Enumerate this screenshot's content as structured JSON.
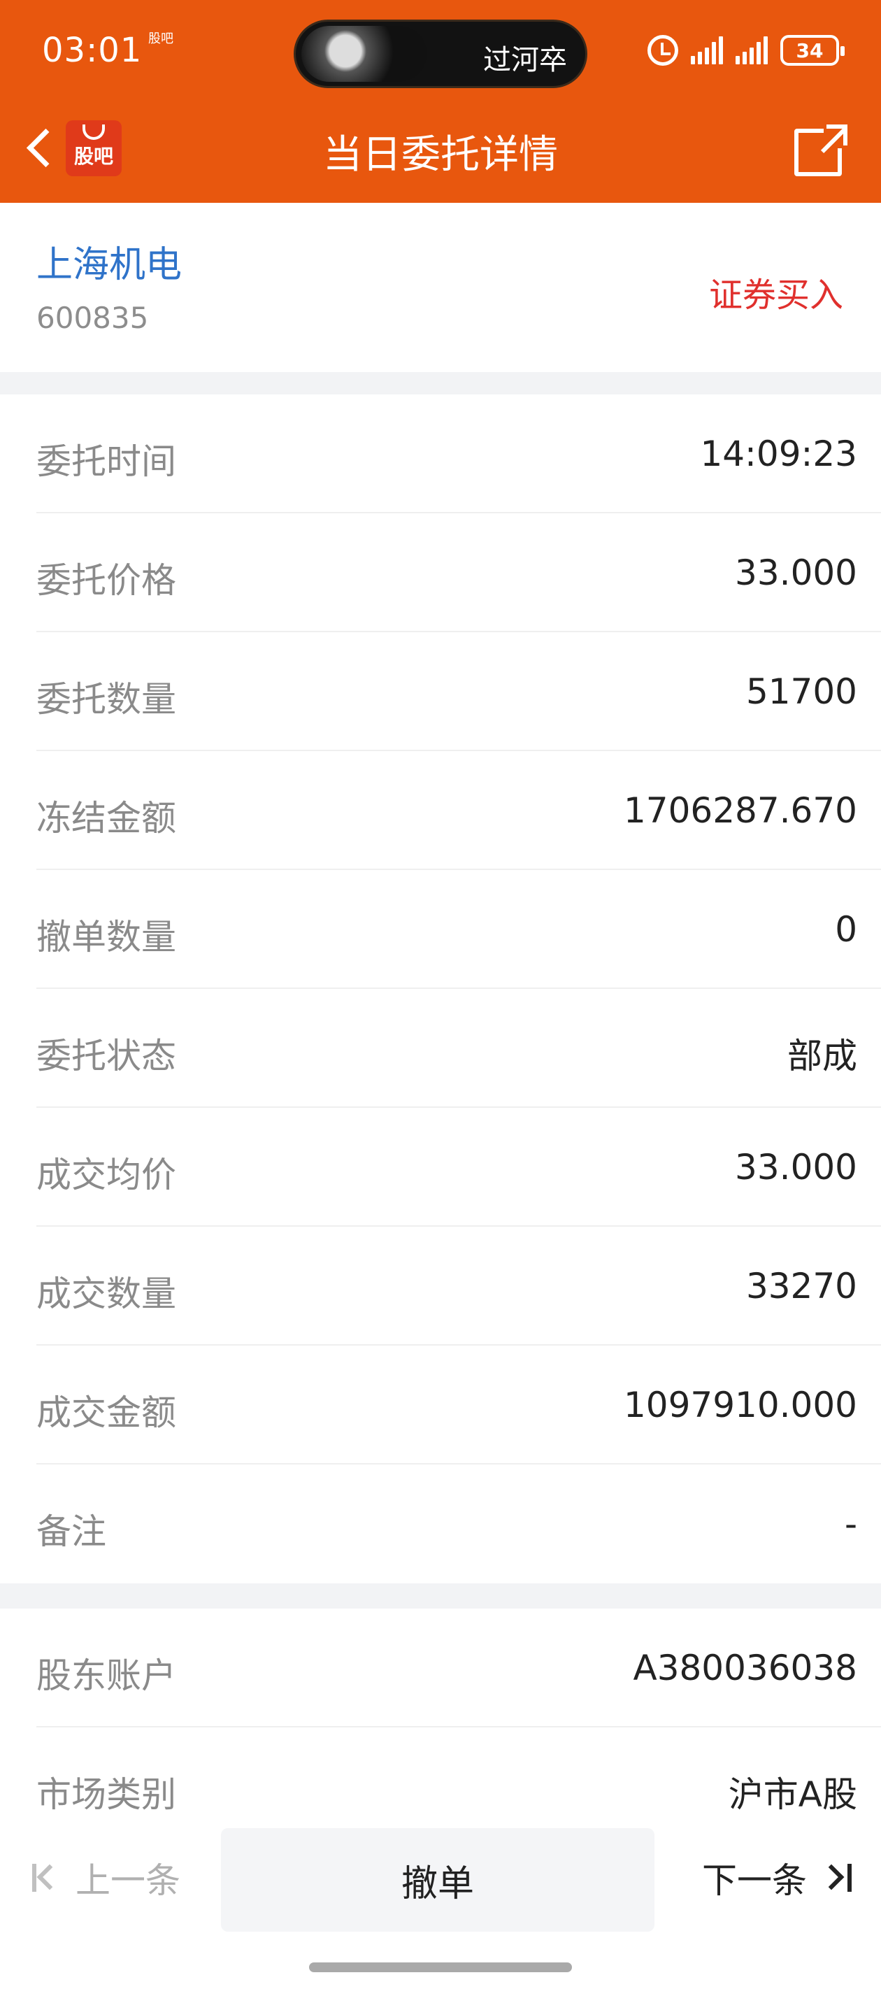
{
  "status_bar": {
    "time": "03:01",
    "app_icon": "股吧",
    "island_text": "过河卒",
    "battery": "34",
    "icons": [
      "alarm-icon",
      "signal-icon",
      "battery-icon"
    ]
  },
  "nav": {
    "title": "当日委托详情",
    "logo_text": "股吧",
    "back_icon": "chevron-left-icon",
    "share_icon": "share-icon"
  },
  "stock": {
    "name": "上海机电",
    "code": "600835",
    "trade_type": "证券买入"
  },
  "details": [
    {
      "label": "委托时间",
      "value": "14:09:23"
    },
    {
      "label": "委托价格",
      "value": "33.000"
    },
    {
      "label": "委托数量",
      "value": "51700"
    },
    {
      "label": "冻结金额",
      "value": "1706287.670"
    },
    {
      "label": "撤单数量",
      "value": "0"
    },
    {
      "label": "委托状态",
      "value": "部成"
    },
    {
      "label": "成交均价",
      "value": "33.000"
    },
    {
      "label": "成交数量",
      "value": "33270"
    },
    {
      "label": "成交金额",
      "value": "1097910.000"
    },
    {
      "label": "备注",
      "value": "-"
    }
  ],
  "account": [
    {
      "label": "股东账户",
      "value": "A380036038"
    },
    {
      "label": "市场类别",
      "value": "沪市A股"
    }
  ],
  "bottom": {
    "prev_label": "上一条",
    "cancel_label": "撤单",
    "next_label": "下一条"
  },
  "colors": {
    "header_bg": "#e8570e",
    "stock_name": "#2f73c9",
    "trade_type": "#e0302d"
  }
}
